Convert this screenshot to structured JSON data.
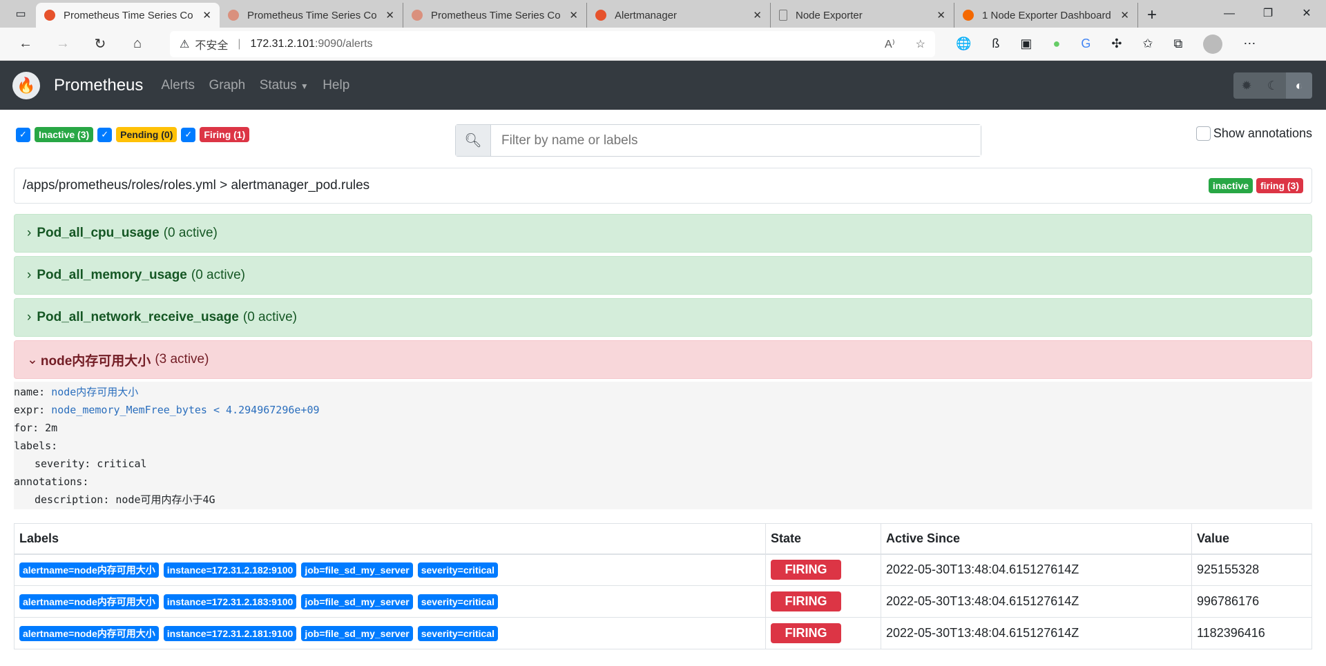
{
  "browser": {
    "tabs": [
      {
        "title": "Prometheus Time Series Co",
        "icon": "prometheus-icon",
        "active": true
      },
      {
        "title": "Prometheus Time Series Co",
        "icon": "prometheus-icon"
      },
      {
        "title": "Prometheus Time Series Co",
        "icon": "prometheus-icon"
      },
      {
        "title": "Alertmanager",
        "icon": "prometheus-icon"
      },
      {
        "title": "Node Exporter",
        "icon": "file-icon"
      },
      {
        "title": "1 Node Exporter Dashboard",
        "icon": "grafana-icon"
      }
    ],
    "security_label": "不安全",
    "url_host": "172.31.2.101",
    "url_path": ":9090/alerts"
  },
  "navbar": {
    "brand": "Prometheus",
    "links": [
      "Alerts",
      "Graph",
      "Status",
      "Help"
    ]
  },
  "filters": {
    "inactive": "Inactive (3)",
    "pending": "Pending (0)",
    "firing": "Firing (1)"
  },
  "search": {
    "placeholder": "Filter by name or labels"
  },
  "show_annotations": "Show annotations",
  "group": {
    "path": "/apps/prometheus/roles/roles.yml > alertmanager_pod.rules",
    "badge_inactive": "inactive",
    "badge_firing": "firing (3)"
  },
  "rules": [
    {
      "name": "Pod_all_cpu_usage",
      "active": "(0 active)"
    },
    {
      "name": "Pod_all_memory_usage",
      "active": "(0 active)"
    },
    {
      "name": "Pod_all_network_receive_usage",
      "active": "(0 active)"
    },
    {
      "name": "node内存可用大小",
      "active": "(3 active)"
    }
  ],
  "rule_detail": {
    "name_key": "name:",
    "name": "node内存可用大小",
    "expr_key": "expr:",
    "expr": "node_memory_MemFree_bytes < 4.294967296e+09",
    "for": "for: 2m",
    "labels_key": "labels:",
    "severity": "severity: critical",
    "annotations_key": "annotations:",
    "description": "description: node可用内存小于4G"
  },
  "table": {
    "headers": [
      "Labels",
      "State",
      "Active Since",
      "Value"
    ],
    "rows": [
      {
        "labels": [
          "alertname=node内存可用大小",
          "instance=172.31.2.182:9100",
          "job=file_sd_my_server",
          "severity=critical"
        ],
        "state": "FIRING",
        "since": "2022-05-30T13:48:04.615127614Z",
        "value": "925155328"
      },
      {
        "labels": [
          "alertname=node内存可用大小",
          "instance=172.31.2.183:9100",
          "job=file_sd_my_server",
          "severity=critical"
        ],
        "state": "FIRING",
        "since": "2022-05-30T13:48:04.615127614Z",
        "value": "996786176"
      },
      {
        "labels": [
          "alertname=node内存可用大小",
          "instance=172.31.2.181:9100",
          "job=file_sd_my_server",
          "severity=critical"
        ],
        "state": "FIRING",
        "since": "2022-05-30T13:48:04.615127614Z",
        "value": "1182396416"
      }
    ]
  }
}
